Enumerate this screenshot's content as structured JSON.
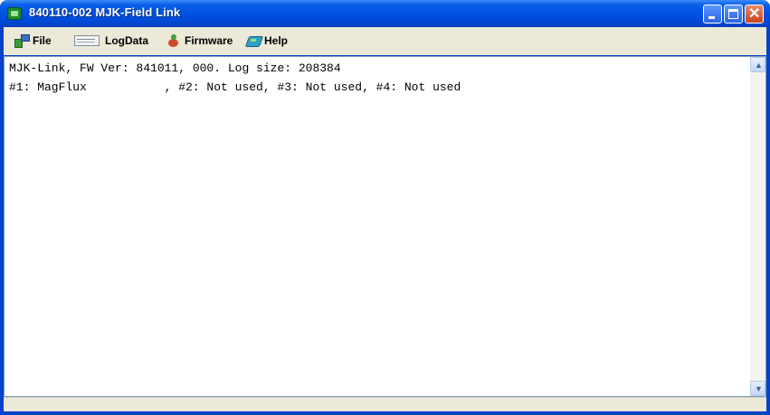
{
  "window": {
    "title": "840110-002 MJK-Field Link",
    "controls": {
      "minimize": "minimize",
      "maximize": "maximize",
      "close": "✕"
    }
  },
  "menu": {
    "items": [
      {
        "label": "File",
        "icon": "file-icon"
      },
      {
        "label": "LogData",
        "icon": "logdata-icon"
      },
      {
        "label": "Firmware",
        "icon": "firmware-icon"
      },
      {
        "label": "Help",
        "icon": "help-icon"
      }
    ]
  },
  "log": {
    "lines": [
      "MJK-Link, FW Ver: 841011, 000. Log size: 208384",
      "#1: MagFlux           , #2: Not used, #3: Not used, #4: Not used"
    ]
  },
  "scroll": {
    "up": "▲",
    "down": "▼"
  },
  "colors": {
    "titlebar": "#0054e3",
    "menubar": "#ece9d8",
    "content_bg": "#ffffff"
  }
}
